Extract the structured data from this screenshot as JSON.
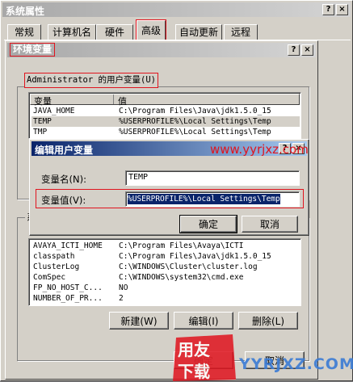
{
  "sys": {
    "title": "系统属性",
    "tabs": [
      "常规",
      "计算机名",
      "硬件",
      "高级",
      "自动更新",
      "远程"
    ]
  },
  "env": {
    "title": "环境变量",
    "user_group": "Administrator 的用户变量(U)",
    "columns": [
      "变量",
      "值"
    ],
    "user_vars": [
      {
        "name": "JAVA_HOME",
        "value": "C:\\Program Files\\Java\\jdk1.5.0_15"
      },
      {
        "name": "TEMP",
        "value": "%USERPROFILE%\\Local Settings\\Temp"
      },
      {
        "name": "TMP",
        "value": "%USERPROFILE%\\Local Settings\\Temp"
      }
    ],
    "sys_group_partial": "系",
    "sys_vars": [
      {
        "name": "AVAYA_ICTI_HOME",
        "value": "C:\\Program Files\\Avaya\\ICTI"
      },
      {
        "name": "classpath",
        "value": "C:\\Program Files\\Java\\jdk1.5.0_15"
      },
      {
        "name": "ClusterLog",
        "value": "C:\\WINDOWS\\Cluster\\cluster.log"
      },
      {
        "name": "ComSpec",
        "value": "C:\\WINDOWS\\system32\\cmd.exe"
      },
      {
        "name": "FP_NO_HOST_C...",
        "value": "NO"
      },
      {
        "name": "NUMBER_OF_PR...",
        "value": "2"
      }
    ],
    "new_btn": "新建(W)",
    "edit_btn": "编辑(I)",
    "delete_btn": "删除(L)",
    "ok_partial": "确定",
    "cancel_btn": "取消"
  },
  "edit": {
    "title": "编辑用户变量",
    "name_label": "变量名(N):",
    "name_value": "TEMP",
    "value_label": "变量值(V):",
    "value_value": "%USERPROFILE%\\Local Settings\\Temp",
    "ok_btn": "确定",
    "cancel_btn": "取消"
  },
  "watermark": {
    "site": "www.yyrjxz.com",
    "logo_top": "用友",
    "logo_bottom": "下载",
    "site2": "YYRJXZ.COM"
  },
  "colors": {
    "active_title_start": "#0a246a",
    "active_title_end": "#a6caf0",
    "highlight": "#0a246a",
    "accent_red": "#e0141e"
  }
}
